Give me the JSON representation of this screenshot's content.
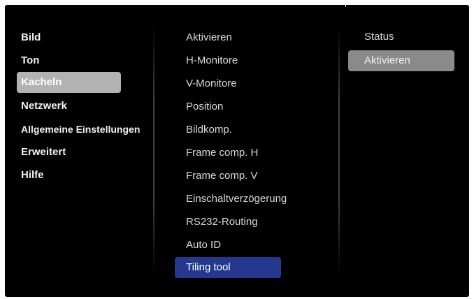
{
  "menu": {
    "items": [
      {
        "label": "Bild"
      },
      {
        "label": "Ton"
      },
      {
        "label": "Kacheln"
      },
      {
        "label": "Netzwerk"
      },
      {
        "label": "Allgemeine Einstellungen"
      },
      {
        "label": "Erweitert"
      },
      {
        "label": "Hilfe"
      }
    ],
    "selected": "Kacheln"
  },
  "submenu": {
    "items": [
      {
        "label": "Aktivieren"
      },
      {
        "label": "H-Monitore"
      },
      {
        "label": "V-Monitore"
      },
      {
        "label": "Position"
      },
      {
        "label": "Bildkomp."
      },
      {
        "label": "Frame comp. H"
      },
      {
        "label": "Frame comp. V"
      },
      {
        "label": "Einschaltverzögerung"
      },
      {
        "label": "RS232-Routing"
      },
      {
        "label": "Auto ID"
      },
      {
        "label": "Tiling tool"
      }
    ],
    "focused": "Tiling tool"
  },
  "options": {
    "items": [
      {
        "label": "Status"
      },
      {
        "label": "Aktivieren"
      }
    ],
    "selected": "Aktivieren"
  },
  "colors": {
    "background": "#000000",
    "menu_selected": "#b2b2b2",
    "submenu_focus": "#243890",
    "option_selected": "#8a8a8a"
  }
}
